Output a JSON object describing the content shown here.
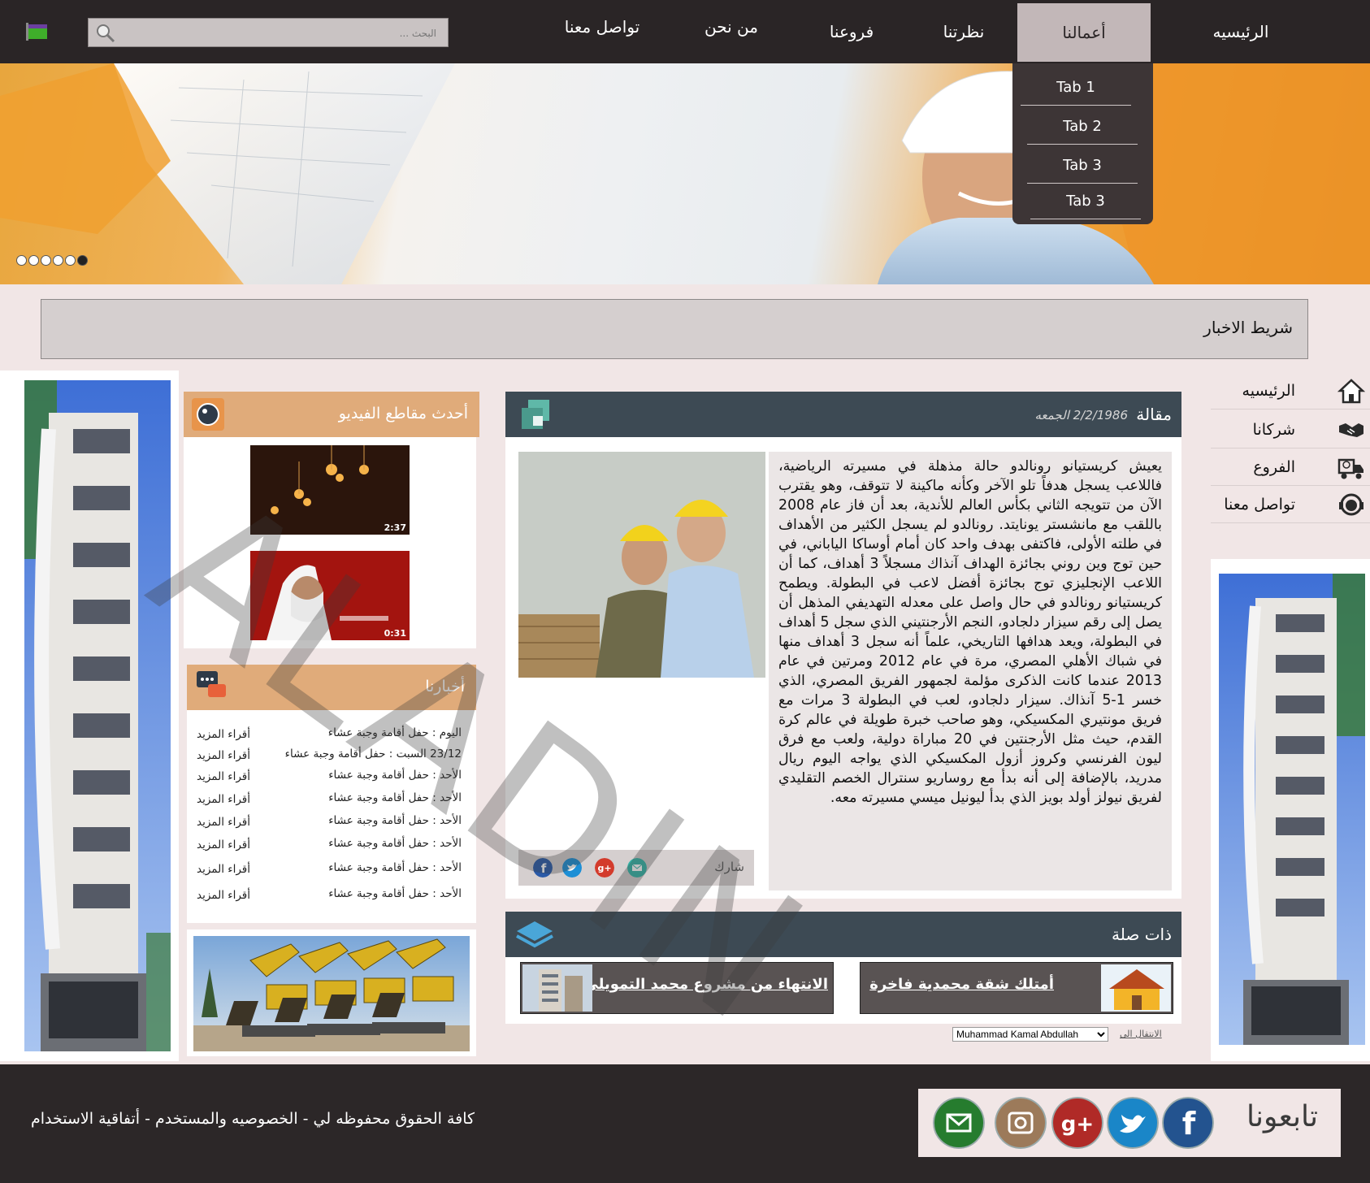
{
  "search": {
    "placeholder": "البحث ..."
  },
  "nav": {
    "items": [
      "الرئيسيه",
      "أعمالنا",
      "نظرتنا",
      "فروعنا",
      "من نحن",
      "تواصل معنا"
    ],
    "active": "أعمالنا",
    "dropdown": [
      "Tab 1",
      "Tab 2",
      "Tab 3",
      "Tab 3"
    ]
  },
  "hero": {
    "slides": 6,
    "active_slide": 6
  },
  "newsbar": {
    "label": "شريط الاخبار"
  },
  "side_menu": [
    {
      "label": "الرئيسيه",
      "icon": "home-icon"
    },
    {
      "label": "شركانا",
      "icon": "handshake-icon"
    },
    {
      "label": "الفروع",
      "icon": "truck-icon"
    },
    {
      "label": "تواصل معنا",
      "icon": "support-icon"
    }
  ],
  "article": {
    "title": "مقالة",
    "date": "2/2/1986 الجمعه",
    "body": "يعيش كريستيانو رونالدو حالة مذهلة في مسيرته الرياضية، فاللاعب يسجل هدفاً تلو الآخر وكأنه ماكينة لا تتوقف، وهو يقترب الآن من تتويجه الثاني بكأس العالم للأندية، بعد أن فاز عام 2008 باللقب مع مانشستر يونايتد. رونالدو لم يسجل الكثير من الأهداف في طلته الأولى، فاكتفى بهدف واحد كان أمام أوساكا الياباني، في حين توج وين روني بجائزة الهداف آنذاك مسجلاً 3 أهداف، كما أن اللاعب الإنجليزي توج بجائزة أفضل لاعب في البطولة. ويطمح كريستيانو رونالدو في حال واصل على معدله التهديفي المذهل أن يصل إلى رقم سيزار دلجادو، النجم الأرجنتيني الذي سجل 5 أهداف في البطولة، ويعد هدافها التاريخي، علماً أنه سجل 3 أهداف منها في شباك الأهلي المصري، مرة في عام 2012 ومرتين في عام 2013 عندما كانت الذكرى مؤلمة لجمهور الفريق المصري، الذي خسر 1-5 آنذاك. سيزار دلجادو، لعب في البطولة 3 مرات مع فريق مونتيري المكسيكي، وهو صاحب خبرة طويلة في عالم كرة القدم، حيث مثل الأرجنتين في 20 مباراة دولية، ولعب مع فرق ليون الفرنسي وكروز أزول المكسيكي الذي يواجه اليوم ريال مدريد، بالإضافة إلى أنه بدأ مع روساريو سنترال الخصم التقليدي لفريق نيولز أولد بويز الذي بدأ ليونيل ميسي مسيرته معه.",
    "share_label": "شارك"
  },
  "related": {
    "title": "ذات صلة",
    "items": [
      "أمتلك شقة محمدية فاخرة",
      "الانتهاء من مشروع محمد التمويلي"
    ],
    "jump_label": "الانتقال الى",
    "jump_value": "Muhammad Kamal Abdullah"
  },
  "videos": {
    "title": "أحدث مقاطع الفيديو",
    "items": [
      {
        "duration": "2:37"
      },
      {
        "duration": "0:31"
      }
    ]
  },
  "news": {
    "title": "أخبارنا",
    "more": "أقراء المزيد",
    "items": [
      "اليوم : حفل أقامة وجبة عشاء",
      "23/12 السبت : حفل أقامة وجبة عشاء",
      "الأحد : حفل أقامة وجبة عشاء",
      "الأحد : حفل أقامة وجبة عشاء",
      "الأحد : حفل أقامة وجبة عشاء",
      "الأحد : حفل أقامة وجبة عشاء",
      "الأحد : حفل أقامة وجبة عشاء",
      "الأحد : حفل أقامة وجبة عشاء"
    ]
  },
  "footer": {
    "copyright": "كافة الحقوق محفوظه لي  - الخصوصيه والمستخدم - أتفاقية الاستخدام",
    "follow_label": "تابعونا",
    "social": [
      "facebook-icon",
      "twitter-icon",
      "google-plus-icon",
      "instagram-icon",
      "email-icon"
    ]
  },
  "watermark": "ALADIN",
  "colors": {
    "nav_bg": "#2a2526",
    "page_bg": "#f1e6e6",
    "dark_header": "#3d4a54",
    "orange_header": "#e0ab7a",
    "active_tab": "#c2b7b8"
  }
}
